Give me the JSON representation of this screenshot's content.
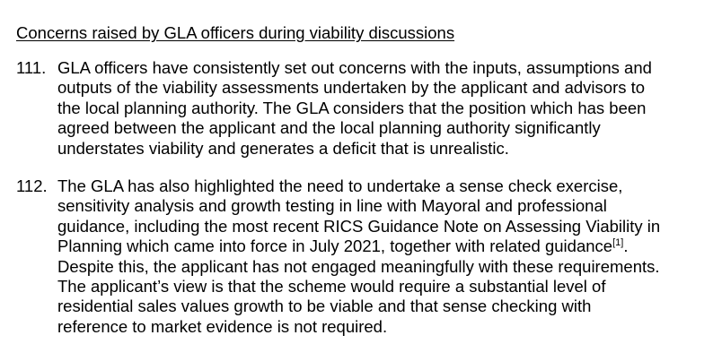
{
  "section": {
    "heading": "Concerns raised by GLA officers during viability discussions"
  },
  "paragraphs": [
    {
      "number": "111.",
      "lines": [
        "GLA officers have consistently set out concerns with the inputs, assumptions and",
        "outputs of the viability assessments undertaken by the applicant and advisors to",
        "the local planning authority. The GLA considers that the position which has been",
        "agreed between the applicant and the local planning authority significantly",
        "understates viability and generates a deficit that is unrealistic."
      ]
    },
    {
      "number": "112.",
      "lines": [
        "The GLA has also highlighted the need to undertake a sense check exercise,",
        "sensitivity analysis and growth testing in line with Mayoral and professional",
        "guidance, including the most recent RICS Guidance Note on Assessing Viability in",
        "Planning which came into force in July 2021, together with related guidance",
        "Despite this, the applicant has not engaged meaningfully with these requirements.",
        "The applicant’s view is that the scheme would require a substantial level of",
        "residential sales values growth to be viable and that sense checking with",
        "reference to market evidence is not required."
      ],
      "footnote_ref": "[1]",
      "after_ref": "."
    }
  ]
}
